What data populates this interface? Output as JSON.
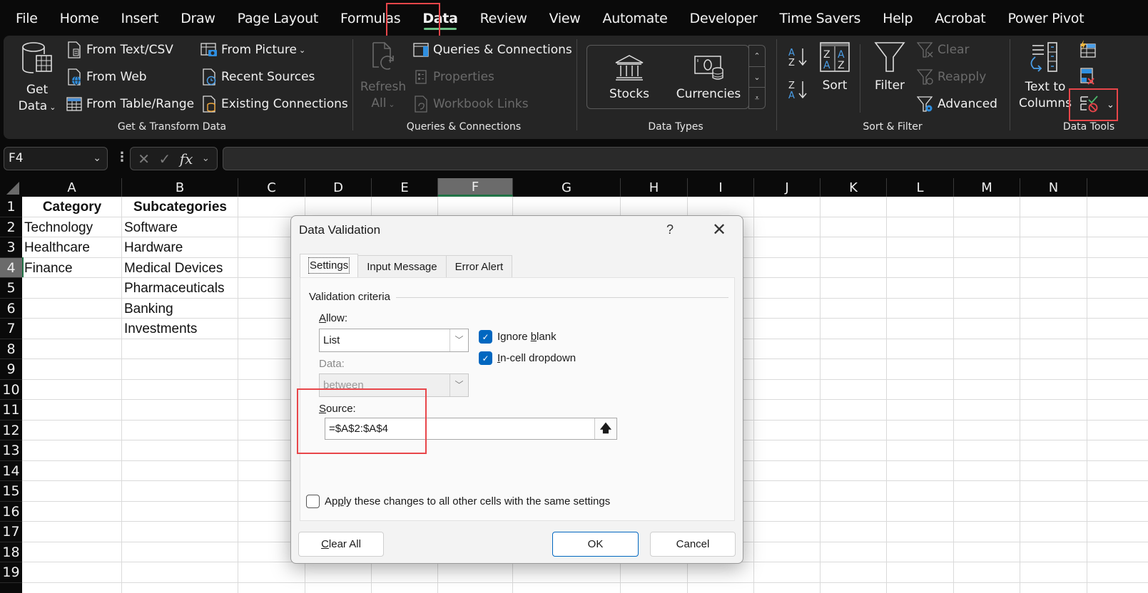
{
  "menu": {
    "tabs": [
      "File",
      "Home",
      "Insert",
      "Draw",
      "Page Layout",
      "Formulas",
      "Data",
      "Review",
      "View",
      "Automate",
      "Developer",
      "Time Savers",
      "Help",
      "Acrobat",
      "Power Pivot"
    ],
    "active_tab": "Data"
  },
  "ribbon": {
    "get_transform": {
      "label": "Get & Transform Data",
      "get_data_line1": "Get",
      "get_data_line2": "Data",
      "from_text_csv": "From Text/CSV",
      "from_web": "From Web",
      "from_table_range": "From Table/Range",
      "from_picture": "From Picture",
      "recent_sources": "Recent Sources",
      "existing_connections": "Existing Connections"
    },
    "queries": {
      "label": "Queries & Connections",
      "refresh_line1": "Refresh",
      "refresh_line2": "All",
      "queries_connections": "Queries & Connections",
      "properties": "Properties",
      "workbook_links": "Workbook Links"
    },
    "data_types": {
      "label": "Data Types",
      "stocks": "Stocks",
      "currencies": "Currencies"
    },
    "sort_filter": {
      "label": "Sort & Filter",
      "sort": "Sort",
      "filter": "Filter",
      "clear": "Clear",
      "reapply": "Reapply",
      "advanced": "Advanced"
    },
    "data_tools": {
      "label": "Data Tools",
      "text_to_columns_line1": "Text to",
      "text_to_columns_line2": "Columns"
    }
  },
  "formula_bar": {
    "name_box": "F4",
    "formula": ""
  },
  "sheet": {
    "columns": [
      "A",
      "B",
      "C",
      "D",
      "E",
      "F",
      "G",
      "H",
      "I",
      "J",
      "K",
      "L",
      "M",
      "N"
    ],
    "selected_column": "F",
    "rows": [
      "1",
      "2",
      "3",
      "4",
      "5",
      "6",
      "7",
      "8",
      "9",
      "10",
      "11",
      "12",
      "13",
      "14",
      "15",
      "16",
      "17",
      "18",
      "19"
    ],
    "selected_row": "4",
    "cells": {
      "A1": "Category",
      "B1": "Subcategories",
      "A2": "Technology",
      "B2": "Software",
      "A3": "Healthcare",
      "B3": "Hardware",
      "A4": "Finance",
      "B4": "Medical Devices",
      "B5": "Pharmaceuticals",
      "B6": "Banking",
      "B7": "Investments"
    }
  },
  "dialog": {
    "title": "Data Validation",
    "help": "?",
    "close": "✕",
    "tabs": [
      "Settings",
      "Input Message",
      "Error Alert"
    ],
    "active_tab": "Settings",
    "section_title": "Validation criteria",
    "allow_label_u": "A",
    "allow_label_rest": "llow:",
    "allow_value": "List",
    "data_label": "Data:",
    "data_value": "between",
    "ignore_blank_pre": "Ignore ",
    "ignore_blank_u": "b",
    "ignore_blank_post": "lank",
    "ignore_blank_checked": true,
    "in_cell_u": "I",
    "in_cell_rest": "n-cell dropdown",
    "in_cell_checked": true,
    "source_label_u": "S",
    "source_label_rest": "ource:",
    "source_value": "=$A$2:$A$4",
    "apply_pre": "Ap",
    "apply_u": "p",
    "apply_post": "ly these changes to all other cells with the same settings",
    "apply_checked": false,
    "clear_all_u": "C",
    "clear_all_rest": "lear All",
    "ok": "OK",
    "cancel": "Cancel"
  },
  "colors": {
    "highlight": "#e8464a",
    "accent_green": "#217346",
    "checkbox_blue": "#0067c0"
  }
}
